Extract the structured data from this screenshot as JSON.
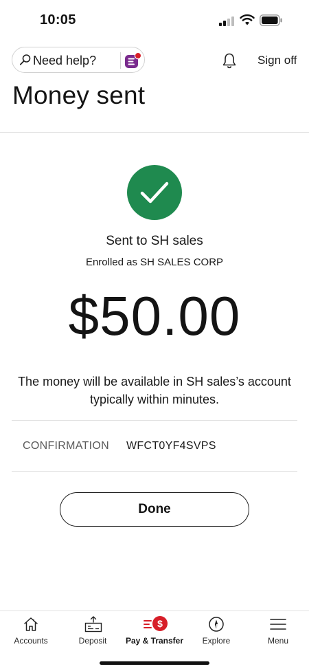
{
  "status_bar": {
    "time": "10:05",
    "icons": [
      "cellular-signal-icon",
      "wifi-icon",
      "battery-icon"
    ]
  },
  "header": {
    "help_placeholder": "Need help?",
    "help_icon": "search-icon",
    "assistant_icon": "fargo-assistant-icon",
    "notifications_icon": "bell-icon",
    "sign_off_label": "Sign off",
    "title": "Money sent"
  },
  "confirmation": {
    "status_icon": "check-circle-icon",
    "sent_to": "Sent to SH sales",
    "enrolled_as": "Enrolled as SH SALES CORP",
    "amount": "$50.00",
    "availability_message": "The money will be available in SH sales’s account typically within minutes.",
    "confirmation_label": "CONFIRMATION",
    "confirmation_number": "WFCT0YF4SVPS",
    "done_label": "Done"
  },
  "bottom_nav": {
    "items": [
      {
        "label": "Accounts",
        "icon": "home-icon",
        "active": false
      },
      {
        "label": "Deposit",
        "icon": "deposit-check-icon",
        "active": false
      },
      {
        "label": "Pay & Transfer",
        "icon": "pay-transfer-icon",
        "active": true
      },
      {
        "label": "Explore",
        "icon": "compass-icon",
        "active": false
      },
      {
        "label": "Menu",
        "icon": "hamburger-menu-icon",
        "active": false
      }
    ]
  },
  "colors": {
    "success_green": "#1f8a4f",
    "brand_red": "#d71e28",
    "text_primary": "#141414",
    "text_muted": "#5a5a5a",
    "divider": "#e2e2e2"
  }
}
